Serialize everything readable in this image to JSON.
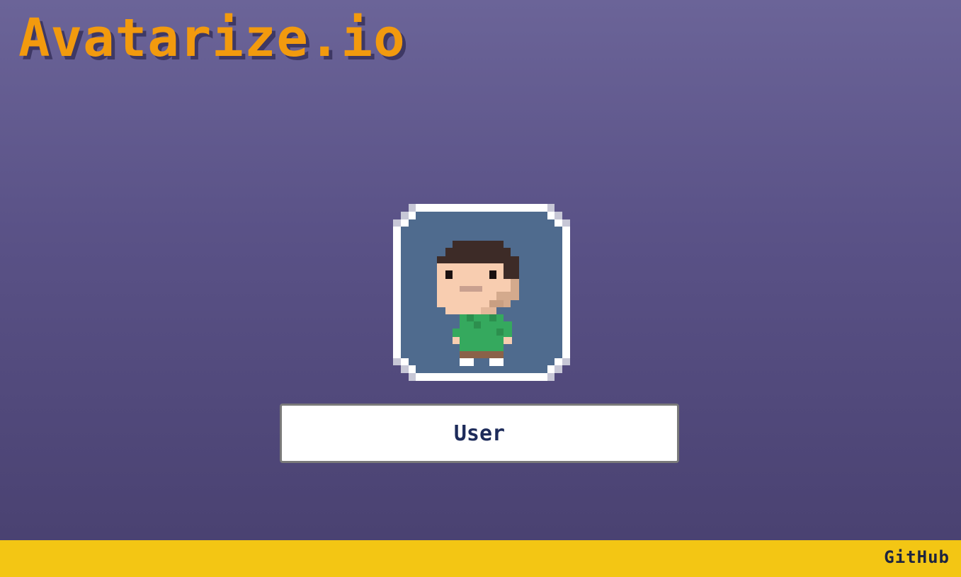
{
  "app": {
    "title": "Avatarize.io"
  },
  "avatar": {
    "icon": "pixel-avatar-icon",
    "background_color": "#4f6b8e",
    "skin_color": "#f8cdb0",
    "hair_color": "#3d2b27",
    "shirt_color": "#35a95e"
  },
  "name_input": {
    "value": "User",
    "placeholder": ""
  },
  "footer": {
    "github_label": "GitHub"
  },
  "colors": {
    "logo": "#f29a0e",
    "footer": "#f3c614",
    "input_text": "#1d2b5a"
  }
}
